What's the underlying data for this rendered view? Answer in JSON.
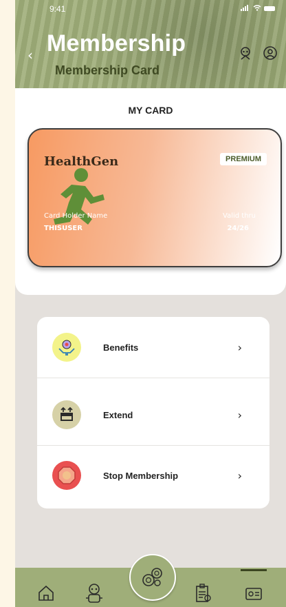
{
  "status": {
    "time": "9:41"
  },
  "header": {
    "back": "‹",
    "title": "Membership",
    "subtitle": "Membership Card"
  },
  "card_section": {
    "heading": "MY CARD",
    "card": {
      "brand": "HealthGen",
      "tier": "PREMIUM",
      "holder_label": "Card Holder Name",
      "holder_name": "THISUSER",
      "valid_label": "Valid thru",
      "valid_date": "24/26"
    }
  },
  "menu": {
    "items": [
      {
        "label": "Benefits",
        "chevron": "›",
        "icon": "gift-hands-icon",
        "icon_bg": "#f3f38a"
      },
      {
        "label": "Extend",
        "chevron": "›",
        "icon": "extend-box-icon",
        "icon_bg": "#d6d1a7"
      },
      {
        "label": "Stop Membership",
        "chevron": "›",
        "icon": "stop-hand-icon",
        "icon_bg": "#e95050"
      }
    ]
  },
  "bottom_nav": {
    "items": [
      {
        "icon": "home-icon"
      },
      {
        "icon": "robot-icon"
      },
      {
        "icon": "center-food-icon"
      },
      {
        "icon": "clipboard-icon"
      },
      {
        "icon": "membership-card-icon"
      }
    ]
  },
  "colors": {
    "accent": "#9fae79",
    "card_orange": "#f79a62",
    "dark_green": "#3f4a23"
  }
}
